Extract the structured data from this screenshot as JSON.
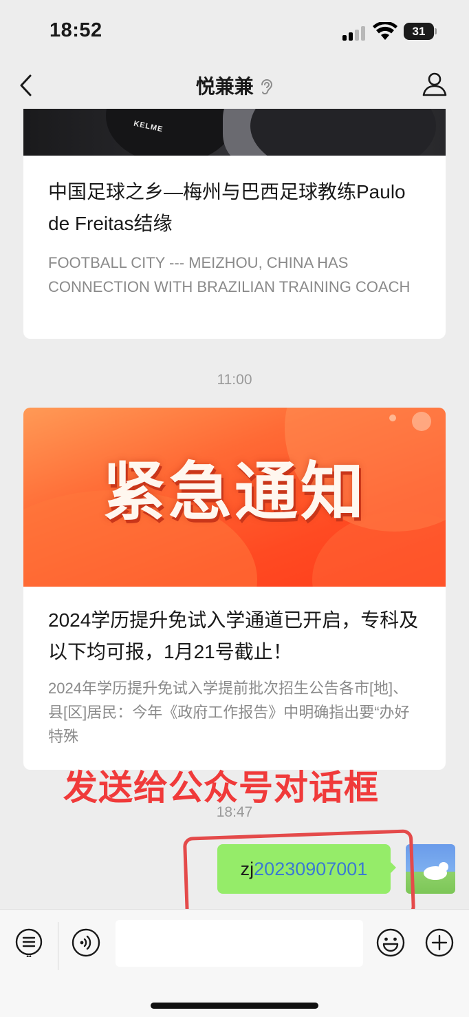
{
  "status_bar": {
    "time": "18:52",
    "battery": "31"
  },
  "header": {
    "title": "悦兼兼",
    "back_icon": "chevron-left-icon",
    "ear_icon": "ear-icon",
    "profile_icon": "person-icon"
  },
  "messages": {
    "article1": {
      "image_logo": "KELME",
      "title": "中国足球之乡—梅州与巴西足球教练Paulo de Freitas结缘",
      "description": "FOOTBALL CITY --- MEIZHOU, CHINA HAS CONNECTION  WITH BRAZILIAN TRAINING COACH"
    },
    "time1": "11:00",
    "article2": {
      "banner_text": "紧急通知",
      "title": "2024学历提升免试入学通道已开启，专科及以下均可报，1月21号截止！",
      "description": "2024年学历提升免试入学提前批次招生公告各市[地]、县[区]居民：今年《政府工作报告》中明确指出要“办好特殊"
    },
    "overlay_annotation": "发送给公众号对话框",
    "time2": "18:47",
    "sent": {
      "prefix": "zj",
      "code": "20230907001"
    }
  },
  "input_bar": {
    "menu_icon": "menu-list-icon",
    "voice_icon": "voice-icon",
    "emoji_icon": "emoji-icon",
    "plus_icon": "plus-icon"
  },
  "colors": {
    "bubble": "#95ec69",
    "annotation_red": "#f03a3a",
    "banner": "#ff4a22",
    "background": "#ededed"
  }
}
